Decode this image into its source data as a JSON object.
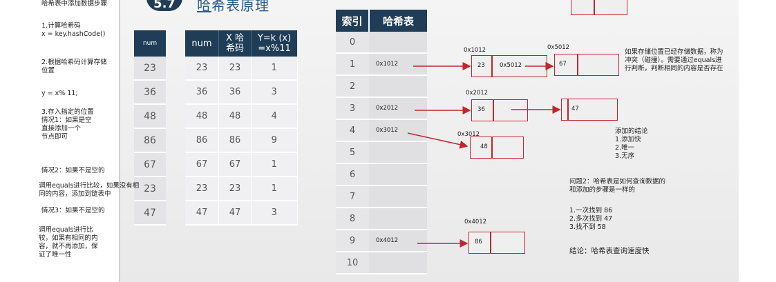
{
  "left_notes": {
    "title": "哈希表中添加数据步骤",
    "step1": "1.计算哈希码\n x = key.hashCode()",
    "step2": "2.根据哈希码计算存储\n位置",
    "formula": "y = x% 11;",
    "step3": "3.存入指定的位置\n 情况1：如果是空\n直接添加一个\n节点即可",
    "case2": " 情况2：如果不是空的",
    "case2_detail": "调用equals进行比较，如果没有相\n同的内容，添加到链表中",
    "case3": " 情况3：如果不是空的",
    "case3_detail": "调用equals进行比\n较，如果有相同的内\n容，就不再添加，保\n证了唯一性"
  },
  "header": {
    "badge": "5.7",
    "title_a": "哈",
    "title_b": "希表原理"
  },
  "num_table": {
    "header": "num",
    "values": [
      "23",
      "36",
      "48",
      "86",
      "67",
      "23",
      "47"
    ]
  },
  "calc_table": {
    "headers": [
      "num",
      "X 哈\n希码",
      "Y=k (x)\n=x%11"
    ],
    "rows": [
      [
        "23",
        "23",
        "1"
      ],
      [
        "36",
        "36",
        "3"
      ],
      [
        "48",
        "48",
        "4"
      ],
      [
        "86",
        "86",
        "9"
      ],
      [
        "67",
        "67",
        "1"
      ],
      [
        "23",
        "23",
        "1"
      ],
      [
        "47",
        "47",
        "3"
      ]
    ]
  },
  "hash_table": {
    "headers": [
      "索引",
      "哈希表"
    ],
    "rows": [
      {
        "index": "0",
        "addr": ""
      },
      {
        "index": "1",
        "addr": "0x1012"
      },
      {
        "index": "2",
        "addr": ""
      },
      {
        "index": "3",
        "addr": "0x2012"
      },
      {
        "index": "4",
        "addr": "0x3012"
      },
      {
        "index": "5",
        "addr": ""
      },
      {
        "index": "6",
        "addr": ""
      },
      {
        "index": "7",
        "addr": ""
      },
      {
        "index": "8",
        "addr": ""
      },
      {
        "index": "9",
        "addr": "0x4012"
      },
      {
        "index": "10",
        "addr": ""
      }
    ]
  },
  "nodes": {
    "n1_addr": "0x1012",
    "n1_val": "23",
    "n1_next": "0x5012",
    "n2_addr": "0x5012",
    "n2_val": "67",
    "n3_addr": "0x2012",
    "n3_val": "36",
    "n4_val": "47",
    "n5_addr": "0x3012",
    "n5_val": "48",
    "n6_addr": "0x4012",
    "n6_val": "86"
  },
  "right_notes": {
    "collision": "如果存储位置已经存储数据，称为\n冲突（碰撞）。需要通过equals进\n行判断，判断相同的内容是否存在",
    "conclusion": "添加的结论\n1.添加快\n2.唯一\n3.无序",
    "question": "问题2：哈希表是如何查询数据的\n和添加的步骤是一样的",
    "lookup": "1.一次找到 86\n2.多次找到 47\n3.找不到 58",
    "summary": "结论：哈希表查询速度快"
  },
  "colors": {
    "header_bg": "#1f3d57",
    "arrow": "#c0262d",
    "title": "#2a5d8a"
  }
}
